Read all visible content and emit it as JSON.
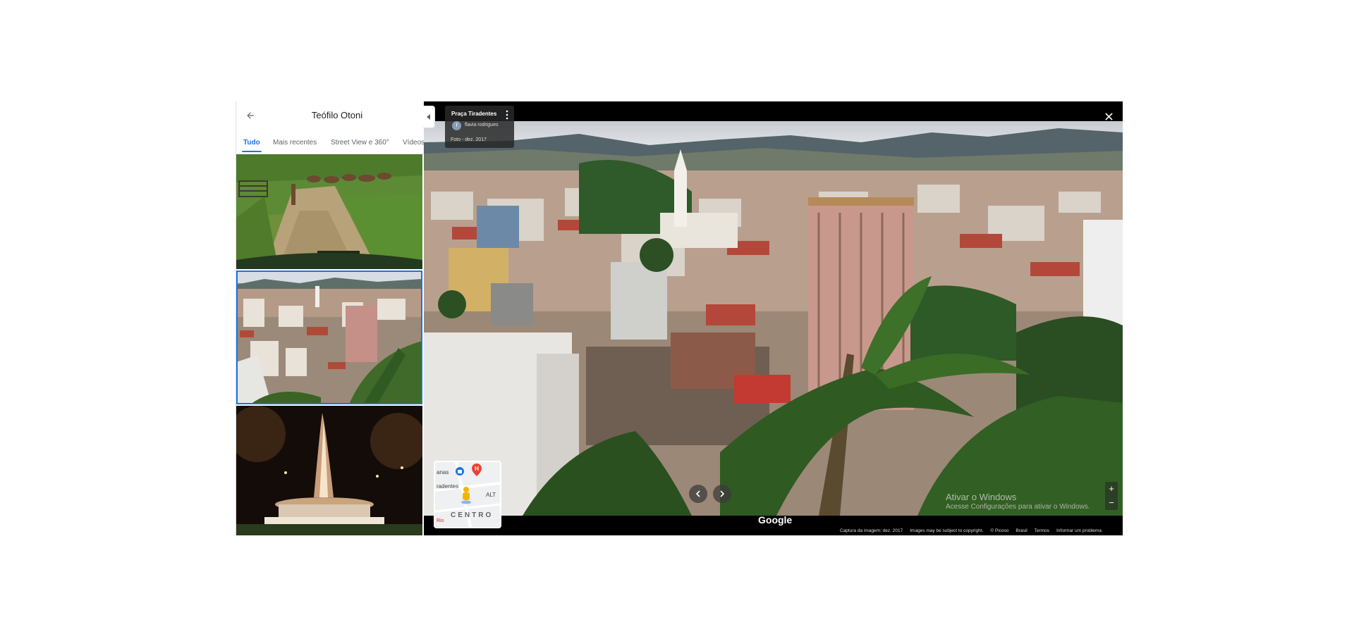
{
  "panel": {
    "title": "Teófilo Otoni",
    "tabs": [
      {
        "label": "Tudo",
        "active": true
      },
      {
        "label": "Mais recentes",
        "active": false
      },
      {
        "label": "Street View e 360°",
        "active": false
      },
      {
        "label": "Vídeos",
        "active": false
      }
    ],
    "thumbnails": [
      {
        "subject": "farm road with horses",
        "selected": false
      },
      {
        "subject": "city aerial view",
        "selected": true
      },
      {
        "subject": "fountain at night",
        "selected": false
      }
    ]
  },
  "photo_info": {
    "title": "Praça Tiradentes",
    "author_initial": "f",
    "author": "flavia rodrigues",
    "date": "Foto - dez. 2017"
  },
  "minimap": {
    "labels": [
      "anas",
      "radentes",
      "ALT",
      "Rio"
    ],
    "area": "CENTRO"
  },
  "watermark": {
    "title": "Ativar o Windows",
    "subtitle": "Acesse Configurações para ativar o Windows."
  },
  "branding": "Google",
  "footer": {
    "capture": "Captura da imagem: dez. 2017",
    "copyright": "Images may be subject to copyright.",
    "credit": "© Picoso",
    "country": "Brasil",
    "terms": "Termos",
    "report": "Informar um problema"
  },
  "colors": {
    "accent": "#1a73e8",
    "viewer_bg": "#000000",
    "map_pin": "#ea4335"
  },
  "icons": {
    "back": "arrow-left-icon",
    "close": "close-icon",
    "menu": "more-vert-icon",
    "prev": "chevron-left-icon",
    "next": "chevron-right-icon",
    "collapse": "caret-left-icon"
  }
}
